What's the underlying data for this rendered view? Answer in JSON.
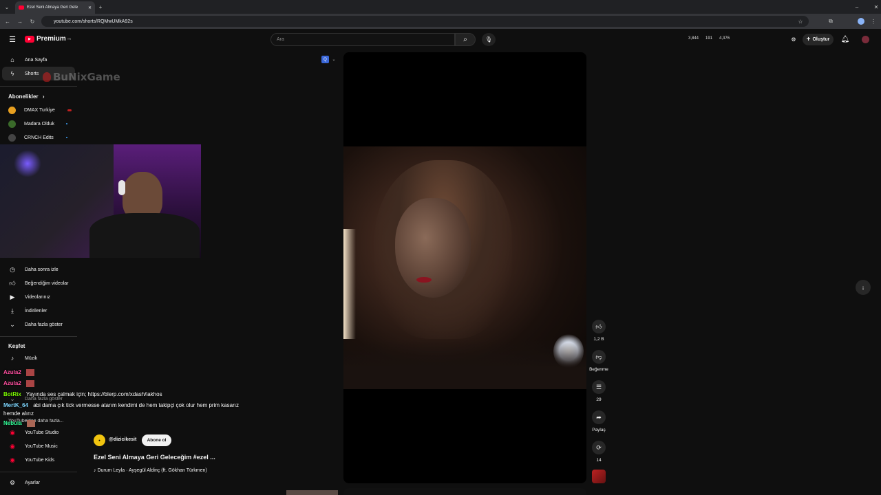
{
  "browser": {
    "tab_title": "Ezel Seni Almaya Geri Gele",
    "url": "youtube.com/shorts/RQMwUMkA92s"
  },
  "header": {
    "logo_text": "Premium",
    "logo_sup": "TR",
    "search_placeholder": "Ara",
    "stats": [
      "3,844",
      "191",
      "4,376"
    ],
    "create_label": "Oluştur"
  },
  "sidebar": {
    "top_items": [
      {
        "label": "Ana Sayfa",
        "icon": "home-icon"
      },
      {
        "label": "Shorts",
        "icon": "shorts-icon"
      }
    ],
    "overlay_logo": "BuNixGame",
    "subs_title": "Abonelikler",
    "subscriptions": [
      "DMAX Turkiye",
      "Madara Olduk",
      "CRNCH Edits"
    ],
    "you_items": [
      {
        "label": "Daha sonra izle",
        "icon": "clock-icon"
      },
      {
        "label": "Beğendiğim videolar",
        "icon": "like-icon"
      },
      {
        "label": "Videolarınız",
        "icon": "video-icon"
      },
      {
        "label": "İndirilenler",
        "icon": "download-icon"
      },
      {
        "label": "Daha fazla göster",
        "icon": "chevron-down-icon"
      }
    ],
    "explore_title": "Keşfet",
    "explore_items": [
      {
        "label": "Müzik",
        "icon": "music-icon"
      },
      {
        "label": "Daha fazla göster",
        "icon": "chevron-down-icon"
      }
    ],
    "more_title": "YouTube'dan daha fazla...",
    "more_items": [
      "YouTube Studio",
      "YouTube Music",
      "YouTube Kids"
    ],
    "settings_label": "Ayarlar"
  },
  "chat": [
    {
      "user": "Azula2",
      "text": "",
      "color": "#ff4fa0"
    },
    {
      "user": "Azula2",
      "text": "",
      "color": "#ff4fa0"
    },
    {
      "user": "BotRix",
      "text": "Yayında ses çalmak için; https://blerp.com/xdash/iakhos",
      "color": "#7cfc00"
    },
    {
      "user": "MertK_64",
      "text": "abi dama çık tick vermesse atarım kendimi de hem takipçi çok olur hem prim kasarız",
      "color": "#7fd7ff"
    },
    {
      "user": "",
      "text": "hemde alırız",
      "color": "#ffffff"
    },
    {
      "user": "Nebula",
      "text": "",
      "color": "#33ff99"
    }
  ],
  "short": {
    "channel": "@dizicikesit",
    "subscribe_label": "Abone ol",
    "title": "Ezel Seni Almaya Geri Geleceğim #ezel ...",
    "music": "♪ Durum Leyla · Ayşegül Aldinç (ft. Gökhan Türkmen)",
    "actions": [
      {
        "icon": "thumbs-up-icon",
        "label": "1,2 B"
      },
      {
        "icon": "thumbs-down-icon",
        "label": "Beğenme"
      },
      {
        "icon": "comment-icon",
        "label": "29"
      },
      {
        "icon": "share-icon",
        "label": "Paylaş"
      },
      {
        "icon": "remix-icon",
        "label": "14"
      }
    ]
  }
}
